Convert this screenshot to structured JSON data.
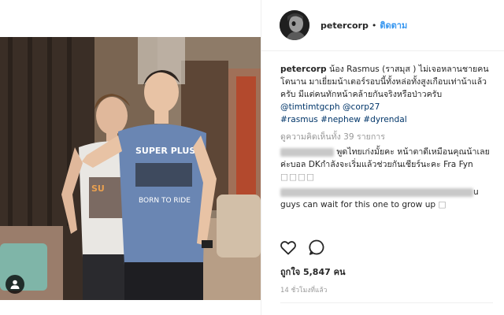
{
  "header": {
    "username": "petercorp",
    "separator": "•",
    "follow_label": "ติดตาม"
  },
  "caption": {
    "username": "petercorp",
    "text_1": " น้อง Rasmus (ราสมุส ) ไม่เจอหลานชายคนโตนาน มาเยี่ยมน้าเตอร์รอบนี้ทั้งหล่อทั้งสูงเกือบเท่าน้าแล้วครับ มีแต่คนทักหน้าคล้ายกันจริงหรือป่าวครับ ",
    "mention_1": "@timtimtgcph",
    "mention_2": "@corp27",
    "hashtag_1": "#rasmus",
    "hashtag_2": "#nephew",
    "hashtag_3": "#dyrendal"
  },
  "view_all_comments": "ดูความคิดเห็นทั้ง 39 รายการ",
  "comments": [
    {
      "text": "พูดไทยเก่งมั้ยคะ หน้าตาดีเหมือนคุณน้าเลยค่ะบอล DKกำลังจะเริ่มแล้วช่วยกันเชียร์นะคะ Fra Fyn",
      "glyphs": "□□□□"
    },
    {
      "text_end": "u",
      "text_2": "guys can wait for this one to grow up",
      "glyphs": "□"
    }
  ],
  "likes": "ถูกใจ 5,847 คน",
  "timestamp": "14 ชั่วโมงที่แล้ว",
  "icons": {
    "like": "heart-icon",
    "comment": "comment-icon",
    "tag": "user-tag-icon"
  },
  "colors": {
    "follow": "#3897f0",
    "link": "#003569",
    "muted": "#999999"
  }
}
